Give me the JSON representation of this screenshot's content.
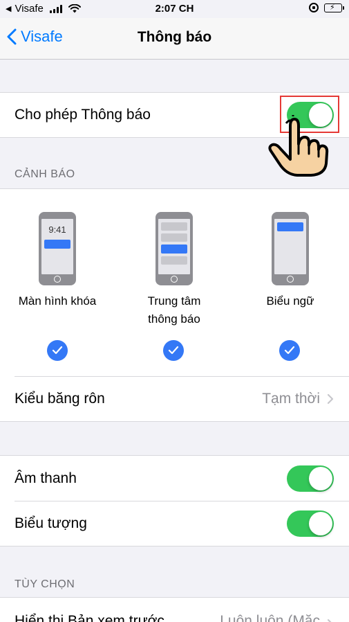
{
  "status_bar": {
    "carrier": "Visafe",
    "time": "2:07 CH"
  },
  "nav": {
    "back_label": "Visafe",
    "title": "Thông báo"
  },
  "allow_notifications": {
    "label": "Cho phép Thông báo",
    "enabled": true
  },
  "alerts": {
    "header": "CẢNH BÁO",
    "items": [
      {
        "label": "Màn hình khóa",
        "checked": true,
        "phone_time": "9:41"
      },
      {
        "label": "Trung tâm thông báo",
        "label_line1": "Trung tâm",
        "label_line2": "thông báo",
        "checked": true
      },
      {
        "label": "Biểu ngữ",
        "checked": true
      }
    ],
    "banner_style": {
      "label": "Kiểu băng rôn",
      "value": "Tạm thời"
    }
  },
  "sound_group": {
    "items": [
      {
        "label": "Âm thanh",
        "enabled": true
      },
      {
        "label": "Biểu tượng",
        "enabled": true
      }
    ]
  },
  "options": {
    "header": "TÙY CHỌN",
    "preview": {
      "label": "Hiển thị Bản xem trước",
      "value": "Luôn luôn (Mặc"
    }
  },
  "colors": {
    "accent": "#007aff",
    "toggle_on": "#34c759",
    "check_blue": "#3478f6",
    "highlight": "#e53935"
  }
}
